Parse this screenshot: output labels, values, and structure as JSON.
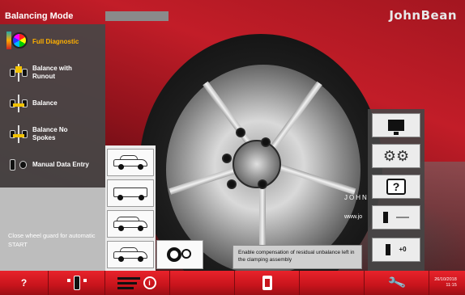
{
  "header": {
    "title": "Balancing Mode",
    "brand": "JohnBean"
  },
  "menu": {
    "items": [
      {
        "label": "Full Diagnostic",
        "active": true
      },
      {
        "label": "Balance with Runout",
        "active": false
      },
      {
        "label": "Balance",
        "active": false
      },
      {
        "label": "Balance No Spokes",
        "active": false
      },
      {
        "label": "Manual Data Entry",
        "active": false
      }
    ],
    "guard_message": "Close wheel guard for automatic START"
  },
  "vehicles": [
    {
      "icon": "car-with-tools-icon"
    },
    {
      "icon": "van-icon"
    },
    {
      "icon": "suv-icon"
    },
    {
      "icon": "sedan-icon"
    }
  ],
  "rim_option": {
    "icon": "rim-clamping-icon"
  },
  "hint": "Enable compensation of residual unbalance left in the clamping assembly",
  "background_text": {
    "brand_small": "JOHN",
    "website": "www.jo"
  },
  "right_panel": {
    "buttons": [
      {
        "icon": "monitor-icon"
      },
      {
        "icon": "settings-gears-icon"
      },
      {
        "icon": "help-manual-icon"
      },
      {
        "icon": "calibration-icon"
      },
      {
        "label": "+0",
        "icon": "zero-offset-icon"
      }
    ],
    "help_glyph": "?"
  },
  "bottom_bar": {
    "help": "?",
    "info_glyph": "i",
    "datetime": {
      "date": "26/10/2018",
      "time": "11:15"
    }
  },
  "colors": {
    "accent_red": "#c8141c",
    "active_menu": "#ffb000",
    "panel_gray": "#464646"
  }
}
